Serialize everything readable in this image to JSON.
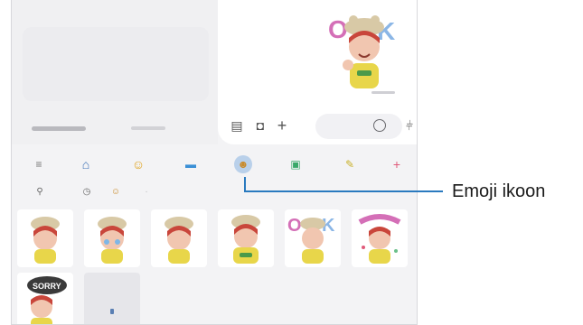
{
  "callout": {
    "label": "Emoji ikoon"
  },
  "toolbar": {
    "items": [
      {
        "name": "menu-icon",
        "glyph": "≡"
      },
      {
        "name": "home-icon",
        "glyph": "⌂"
      },
      {
        "name": "smiley-icon",
        "glyph": "☺"
      },
      {
        "name": "gif-icon",
        "glyph": "▬"
      },
      {
        "name": "ar-emoji-icon",
        "glyph": "☻",
        "selected": true
      },
      {
        "name": "sticker-icon",
        "glyph": "▣"
      },
      {
        "name": "pen-icon",
        "glyph": "✎"
      },
      {
        "name": "plus-icon",
        "glyph": "+"
      }
    ]
  },
  "subbar": {
    "items": [
      {
        "name": "search-icon",
        "glyph": "⚲"
      },
      {
        "name": "recent-icon",
        "glyph": "◷"
      },
      {
        "name": "emoji-pack-icon",
        "glyph": "☺"
      },
      {
        "name": "more-icon",
        "glyph": "·"
      }
    ]
  },
  "stickers": [
    {
      "name": "sticker-hat-boy"
    },
    {
      "name": "sticker-crying"
    },
    {
      "name": "sticker-smirk"
    },
    {
      "name": "sticker-ok-sign"
    },
    {
      "name": "sticker-ok-text"
    },
    {
      "name": "sticker-thanks"
    },
    {
      "name": "sticker-sorry"
    },
    {
      "name": "sticker-download"
    }
  ],
  "colors": {
    "accent": "#2a7abf",
    "selected_bg": "#b9d0ea"
  }
}
